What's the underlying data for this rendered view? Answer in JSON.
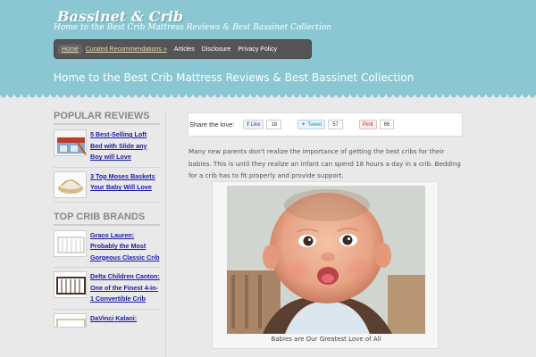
{
  "header": {
    "site_title": "Bassinet & Crib",
    "tagline": "Home to the Best Crib Mattress Reviews & Best Bassinet Collection",
    "page_heading": "Home to the Best Crib Mattress Reviews & Best Bassinet Collection"
  },
  "nav": {
    "items": [
      {
        "label": "Home"
      },
      {
        "label": "Curated Recommendations »"
      },
      {
        "label": "Articles"
      },
      {
        "label": "Disclosure"
      },
      {
        "label": "Privacy Policy"
      }
    ]
  },
  "sidebar": {
    "popular_title": "POPULAR REVIEWS",
    "popular_items": [
      {
        "label": "5 Best-Selling Loft Bed with Slide any Boy will Love"
      },
      {
        "label": "3 Top Moses Baskets Your Baby Will Love"
      }
    ],
    "brands_title": "TOP CRIB BRANDS",
    "brand_items": [
      {
        "label": "Graco Lauren: Probably the Most Gorgeous Classic Crib"
      },
      {
        "label": "Delta Children Canton: One of the Finest 4-in-1 Convertible Crib"
      },
      {
        "label": "DaVinci Kalani:"
      }
    ]
  },
  "share": {
    "label": "Share the love:",
    "like_label": "Like",
    "like_count": "18",
    "tweet_label": "Tweet",
    "tweet_count": "57",
    "pin_label": "Pinit",
    "pin_count": "66"
  },
  "article": {
    "intro": "Many new parents don't realize the importance of getting the best cribs for their babies. This is until they realize an infant can spend 18 hours a day in a crib. Bedding for a crib has to fit properly and provide support.",
    "caption": "Babies are Our Greatest Love of All"
  },
  "colors": {
    "header_bg": "#8ac7d3",
    "page_bg": "#e9e9e9",
    "nav_bg": "#555555",
    "link": "#1a1aa6"
  }
}
